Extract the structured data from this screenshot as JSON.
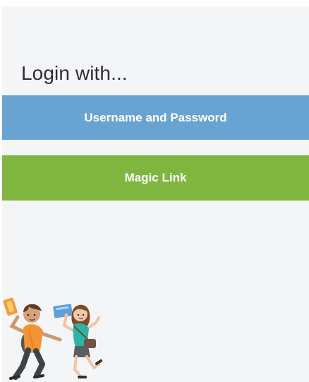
{
  "login": {
    "title": "Login with...",
    "password_button_label": "Username and Password",
    "magic_link_button_label": "Magic Link"
  },
  "colors": {
    "background": "#f4f5f7",
    "password_button": "#69a3d1",
    "magic_link_button": "#80b640",
    "title_text": "#2f2f33",
    "button_text": "#ffffff"
  },
  "illustration": {
    "name": "jumping-students-illustration"
  }
}
